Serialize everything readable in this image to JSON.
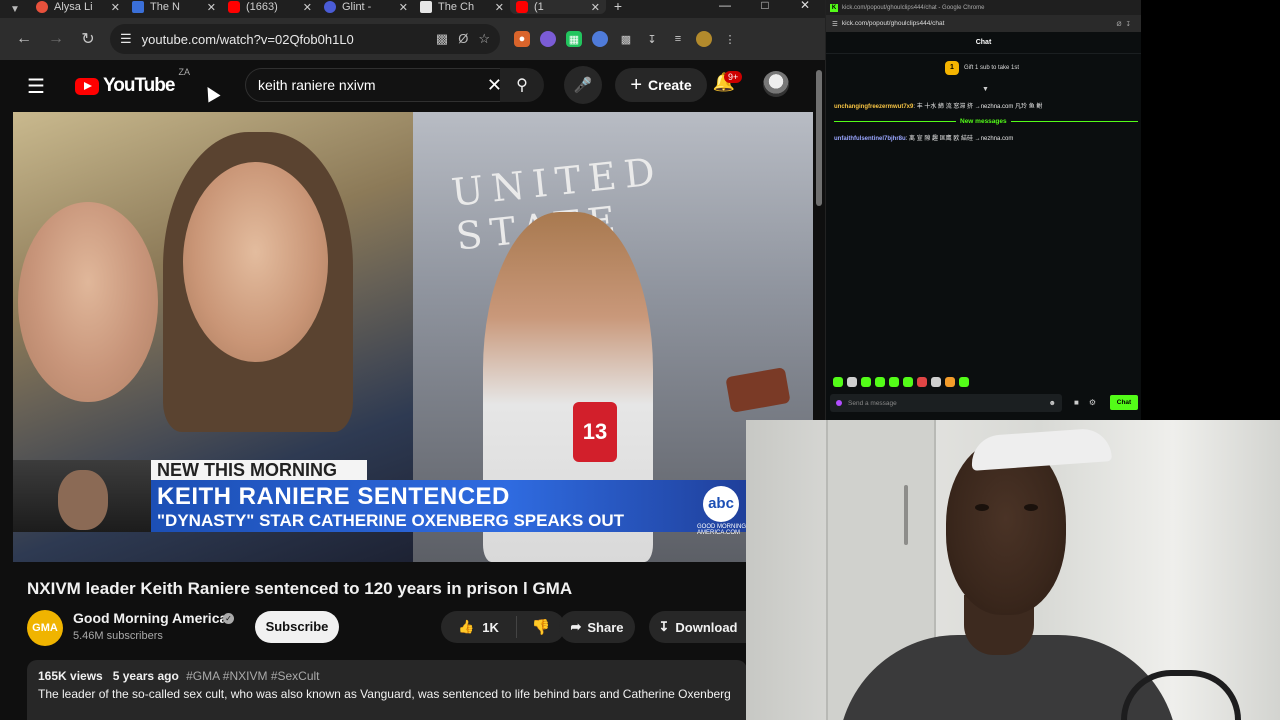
{
  "browser": {
    "tabs": [
      {
        "title": "Alysa Li",
        "fav_color": "#e8513c",
        "active": false
      },
      {
        "title": "The N",
        "fav_color": "#3a6fd8",
        "active": false
      },
      {
        "title": "(1663)",
        "fav_color": "#ff0000",
        "active": false
      },
      {
        "title": "Glint -",
        "fav_color": "#4a5cd6",
        "active": false
      },
      {
        "title": "The Ch",
        "fav_color": "#e6e6e6",
        "active": false
      },
      {
        "title": "(1",
        "fav_color": "#ff0000",
        "active": true
      }
    ],
    "url": "youtube.com/watch?v=02Qfob0h1L0",
    "icons": {
      "back": "back-arrow-icon",
      "forward": "forward-arrow-icon",
      "reload": "reload-icon",
      "site_info": "tune-icon",
      "cast": "cast-icon",
      "eye_off": "eye-off-icon",
      "bookmark": "star-icon",
      "downloads": "download-icon",
      "menu": "kebab-menu-icon"
    }
  },
  "youtube": {
    "logo_text": "YouTube",
    "region": "ZA",
    "search_value": "keith raniere nxivm",
    "create_label": "Create",
    "notification_badge": "9+",
    "video_overlay": {
      "tag": "NEW THIS MORNING",
      "headline": "KEITH RANIERE SENTENCED",
      "subheadline": "\"DYNASTY\" STAR CATHERINE OXENBERG SPEAKS OUT",
      "network_logo": "abc",
      "network_sub": "GOOD MORNING AMERICA.COM",
      "building_text": "UNITED STATE",
      "mic_number": "13"
    },
    "title": "NXIVM leader Keith Raniere sentenced to 120 years in prison l GMA",
    "channel": {
      "avatar_text": "GMA",
      "name": "Good Morning America",
      "subscribers": "5.46M subscribers"
    },
    "subscribe_label": "Subscribe",
    "like_count": "1K",
    "share_label": "Share",
    "download_label": "Download",
    "views": "165K views",
    "age": "5 years ago",
    "tags": "#GMA #NXIVM #SexCult",
    "description": "The leader of the so-called sex cult, who was also known as Vanguard, was sentenced to life behind bars and Catherine Oxenberg"
  },
  "kick_chat": {
    "window_title": "kick.com/popout/ghoulclips444/chat - Google Chrome",
    "url": "kick.com/popout/ghoulclips444/chat",
    "header": "Chat",
    "gift_count": "1",
    "gift_text": "Gift 1 sub to take 1st",
    "messages": [
      {
        "user": "unchangingfreezermwut7x9",
        "text": ": 丰 十水 締 流 窓滞 挤 →nezhna.com 凡玲 鱼 鲋"
      },
      {
        "user": "unfaithfulsentinel7bjhr8u",
        "text": ": 离 宣 隙 趣 匡鹰 欧 結硅 →nezhna.com"
      }
    ],
    "new_messages_label": "New messages",
    "input_placeholder": "Send a message",
    "chat_button": "Chat"
  }
}
